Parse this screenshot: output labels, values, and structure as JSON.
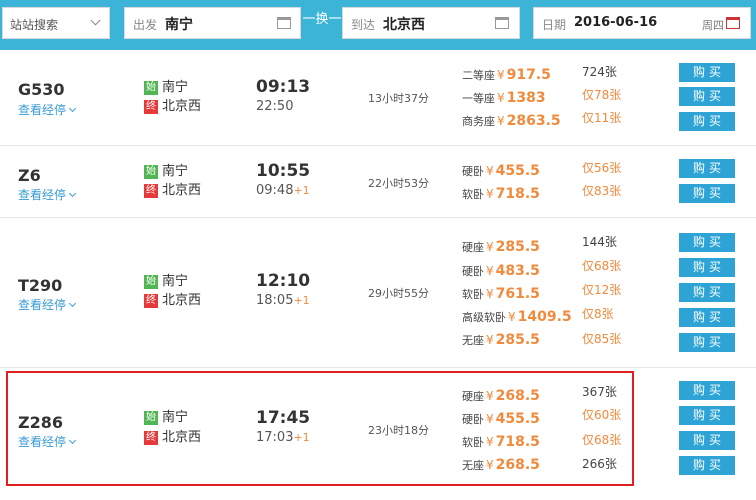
{
  "search": {
    "mode_label": "站站搜索",
    "from_label": "出发",
    "from_value": "南宁",
    "swap_label": "一换一",
    "to_label": "到达",
    "to_value": "北京西",
    "date_label": "日期",
    "date_value": "2016-06-16",
    "weekday": "周四"
  },
  "labels": {
    "view_stops": "查看经停",
    "start_badge": "始",
    "end_badge": "终",
    "buy": "购买",
    "currency": "¥"
  },
  "trains": [
    {
      "number": "G530",
      "from": "南宁",
      "to": "北京西",
      "depart": "09:13",
      "arrive": "22:50",
      "arrive_plus": "",
      "duration": "13小时37分",
      "seats": [
        {
          "type": "二等座",
          "price": "917.5",
          "remain": "724张",
          "few": false
        },
        {
          "type": "一等座",
          "price": "1383",
          "remain": "仅78张",
          "few": true
        },
        {
          "type": "商务座",
          "price": "2863.5",
          "remain": "仅11张",
          "few": true
        }
      ]
    },
    {
      "number": "Z6",
      "from": "南宁",
      "to": "北京西",
      "depart": "10:55",
      "arrive": "09:48",
      "arrive_plus": "+1",
      "duration": "22小时53分",
      "seats": [
        {
          "type": "硬卧",
          "price": "455.5",
          "remain": "仅56张",
          "few": true
        },
        {
          "type": "软卧",
          "price": "718.5",
          "remain": "仅83张",
          "few": true
        }
      ]
    },
    {
      "number": "T290",
      "from": "南宁",
      "to": "北京西",
      "depart": "12:10",
      "arrive": "18:05",
      "arrive_plus": "+1",
      "duration": "29小时55分",
      "seats": [
        {
          "type": "硬座",
          "price": "285.5",
          "remain": "144张",
          "few": false
        },
        {
          "type": "硬卧",
          "price": "483.5",
          "remain": "仅68张",
          "few": true
        },
        {
          "type": "软卧",
          "price": "761.5",
          "remain": "仅12张",
          "few": true
        },
        {
          "type": "高级软卧",
          "price": "1409.5",
          "remain": "仅8张",
          "few": true
        },
        {
          "type": "无座",
          "price": "285.5",
          "remain": "仅85张",
          "few": true
        }
      ]
    },
    {
      "number": "Z286",
      "from": "南宁",
      "to": "北京西",
      "depart": "17:45",
      "arrive": "17:03",
      "arrive_plus": "+1",
      "duration": "23小时18分",
      "seats": [
        {
          "type": "硬座",
          "price": "268.5",
          "remain": "367张",
          "few": false
        },
        {
          "type": "硬卧",
          "price": "455.5",
          "remain": "仅60张",
          "few": true
        },
        {
          "type": "软卧",
          "price": "718.5",
          "remain": "仅68张",
          "few": true
        },
        {
          "type": "无座",
          "price": "268.5",
          "remain": "266张",
          "few": false
        }
      ]
    }
  ],
  "colors": {
    "header_bg": "#3cb4d8",
    "price": "#f08a3c",
    "buy_button": "#2ea4d6",
    "highlight": "#e02020",
    "link": "#3a9bd4"
  }
}
